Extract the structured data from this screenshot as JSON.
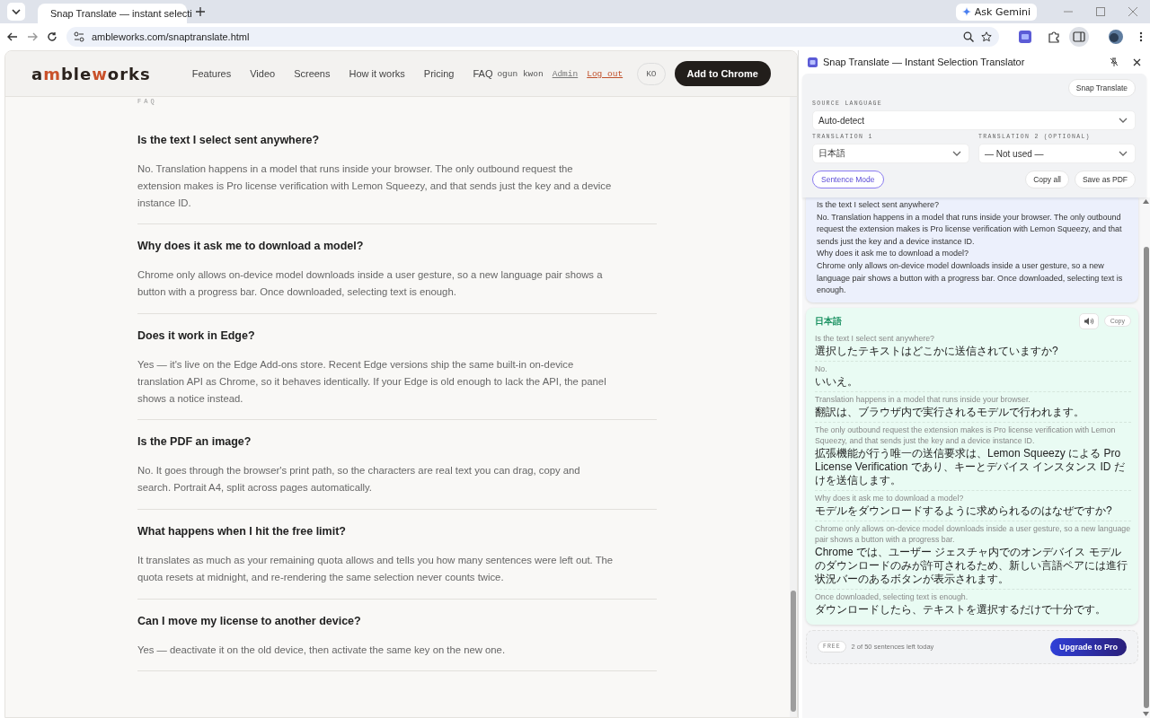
{
  "browser": {
    "tab": {
      "title": "Snap Translate — instant selecti",
      "selected": true
    },
    "ask_gemini": "Ask Gemini",
    "address": "ambleworks.com/snaptranslate.html"
  },
  "site": {
    "logo": [
      {
        "text": "a",
        "accent": false
      },
      {
        "text": "m",
        "accent": true
      },
      {
        "text": "ble",
        "accent": false
      },
      {
        "text": "w",
        "accent": true
      },
      {
        "text": "orks",
        "accent": false
      }
    ],
    "nav": [
      "Features",
      "Video",
      "Screens",
      "How it works",
      "Pricing",
      "FAQ"
    ],
    "user": "ogun kwon",
    "admin_link": "Admin",
    "logout_link": "Log out",
    "language_badge": "KO",
    "cta": "Add to Chrome",
    "section_label": "FAQ",
    "faq": [
      {
        "question": "Is the text I select sent anywhere?",
        "answer": "No. Translation happens in a model that runs inside your browser. The only outbound request the extension makes is Pro license verification with Lemon Squeezy, and that sends just the key and a device instance ID."
      },
      {
        "question": "Why does it ask me to download a model?",
        "answer": "Chrome only allows on-device model downloads inside a user gesture, so a new language pair shows a button with a progress bar. Once downloaded, selecting text is enough."
      },
      {
        "question": "Does it work in Edge?",
        "answer": "Yes — it's live on the Edge Add-ons store. Recent Edge versions ship the same built-in on-device translation API as Chrome, so it behaves identically. If your Edge is old enough to lack the API, the panel shows a notice instead."
      },
      {
        "question": "Is the PDF an image?",
        "answer": "No. It goes through the browser's print path, so the characters are real text you can drag, copy and search. Portrait A4, split across pages automatically."
      },
      {
        "question": "What happens when I hit the free limit?",
        "answer": "It translates as much as your remaining quota allows and tells you how many sentences were left out. The quota resets at midnight, and re-rendering the same selection never counts twice."
      },
      {
        "question": "Can I move my license to another device?",
        "answer": "Yes — deactivate it on the old device, then activate the same key on the new one."
      }
    ]
  },
  "panel": {
    "title": "Snap Translate — Instant Selection Translator",
    "snap_button": "Snap Translate",
    "source_label": "SOURCE LANGUAGE",
    "source_value": "Auto-detect",
    "translation1_label": "TRANSLATION 1",
    "translation1_value": "日本語",
    "translation2_label": "TRANSLATION 2 (OPTIONAL)",
    "translation2_value": "— Not used —",
    "sentence_mode": {
      "label": "Sentence Mode",
      "on": true
    },
    "copy_all": "Copy all",
    "save_pdf": "Save as PDF",
    "source_lines": [
      "Is the text I select sent anywhere?",
      "No. Translation happens in a model that runs inside your browser. The only outbound request the extension makes is Pro license verification with Lemon Squeezy, and that sends just the key and a device instance ID.",
      "Why does it ask me to download a model?",
      "Chrome only allows on-device model downloads inside a user gesture, so a new language pair shows a button with a progress bar. Once downloaded, selecting text is enough."
    ],
    "result": {
      "language": "日本語",
      "copy": "Copy",
      "pairs": [
        {
          "source": "Is the text I select sent anywhere?",
          "target": "選択したテキストはどこかに送信されていますか?"
        },
        {
          "source": "No.",
          "target": "いいえ。"
        },
        {
          "source": "Translation happens in a model that runs inside your browser.",
          "target": "翻訳は、ブラウザ内で実行されるモデルで行われます。"
        },
        {
          "source": "The only outbound request the extension makes is Pro license verification with Lemon Squeezy, and that sends just the key and a device instance ID.",
          "target": "拡張機能が行う唯一の送信要求は、Lemon Squeezy による Pro License Verification であり、キーとデバイス インスタンス ID だけを送信します。"
        },
        {
          "source": "Why does it ask me to download a model?",
          "target": "モデルをダウンロードするように求められるのはなぜですか?"
        },
        {
          "source": "Chrome only allows on-device model downloads inside a user gesture, so a new language pair shows a button with a progress bar.",
          "target": "Chrome では、ユーザー ジェスチャ内でのオンデバイス モデルのダウンロードのみが許可されるため、新しい言語ペアには進行状況バーのあるボタンが表示されます。"
        },
        {
          "source": "Once downloaded, selecting text is enough.",
          "target": "ダウンロードしたら、テキストを選択するだけで十分です。"
        }
      ]
    },
    "plan_badge": "FREE",
    "quota": "2 of 50 sentences left today",
    "upgrade": "Upgrade to Pro"
  }
}
